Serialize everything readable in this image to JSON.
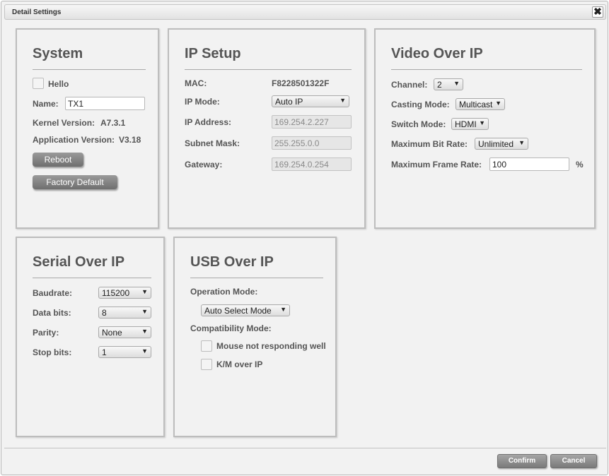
{
  "dialog": {
    "title": "Detail Settings",
    "close_glyph": "✖"
  },
  "system": {
    "heading": "System",
    "hello_label": "Hello",
    "hello_checked": false,
    "name_label": "Name:",
    "name_value": "TX1",
    "kernel_label": "Kernel Version:",
    "kernel_value": "A7.3.1",
    "app_label": "Application Version:",
    "app_value": "V3.18",
    "reboot_label": "Reboot",
    "factory_label": "Factory Default"
  },
  "ip_setup": {
    "heading": "IP Setup",
    "mac_label": "MAC:",
    "mac_value": "F8228501322F",
    "mode_label": "IP Mode:",
    "mode_value": "Auto IP",
    "address_label": "IP Address:",
    "address_value": "169.254.2.227",
    "subnet_label": "Subnet Mask:",
    "subnet_value": "255.255.0.0",
    "gateway_label": "Gateway:",
    "gateway_value": "169.254.0.254"
  },
  "video": {
    "heading": "Video Over IP",
    "channel_label": "Channel:",
    "channel_value": "2",
    "casting_label": "Casting Mode:",
    "casting_value": "Multicast",
    "switch_label": "Switch Mode:",
    "switch_value": "HDMI",
    "bitrate_label": "Maximum Bit Rate:",
    "bitrate_value": "Unlimited",
    "framerate_label": "Maximum Frame Rate:",
    "framerate_value": "100",
    "framerate_unit": "%"
  },
  "serial": {
    "heading": "Serial Over IP",
    "baud_label": "Baudrate:",
    "baud_value": "115200",
    "databits_label": "Data bits:",
    "databits_value": "8",
    "parity_label": "Parity:",
    "parity_value": "None",
    "stopbits_label": "Stop bits:",
    "stopbits_value": "1"
  },
  "usb": {
    "heading": "USB Over IP",
    "opmode_label": "Operation Mode:",
    "opmode_value": "Auto Select Mode",
    "compat_label": "Compatibility Mode:",
    "mouse_label": "Mouse not responding well",
    "mouse_checked": false,
    "km_label": "K/M over IP",
    "km_checked": false
  },
  "footer": {
    "confirm_label": "Confirm",
    "cancel_label": "Cancel"
  },
  "icons": {
    "dropdown": "dropdown-arrow-icon",
    "close": "close-icon"
  },
  "colors": {
    "panel_border": "#bdbdbd",
    "button_gray": "#808080",
    "background": "#f2f2f2"
  }
}
